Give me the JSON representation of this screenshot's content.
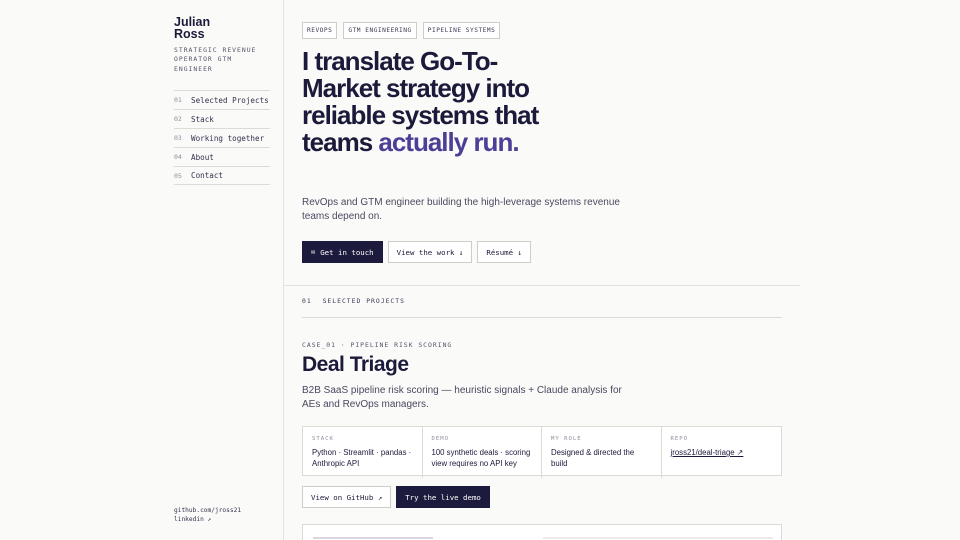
{
  "brand": {
    "name": "Julian Ross",
    "role": "STRATEGIC REVENUE OPERATOR GTM ENGINEER"
  },
  "nav": [
    {
      "num": "01",
      "label": "Selected Projects"
    },
    {
      "num": "02",
      "label": "Stack"
    },
    {
      "num": "03",
      "label": "Working together"
    },
    {
      "num": "04",
      "label": "About"
    },
    {
      "num": "05",
      "label": "Contact"
    }
  ],
  "side_links": {
    "github": "github.com/jross21",
    "linkedin": "linkedin ↗"
  },
  "tags": [
    "REVOPS",
    "GTM ENGINEERING",
    "PIPELINE SYSTEMS"
  ],
  "hero": {
    "headline": "I translate Go-To-Market strategy into reliable systems that teams",
    "accent": "actually run.",
    "lede": "RevOps and GTM engineer building the high-leverage systems revenue teams depend on."
  },
  "ctas": {
    "contact_icon": "✉",
    "contact": "Get in touch",
    "work": "View the work ↓",
    "resume": "Résumé ↓"
  },
  "section": {
    "num": "01",
    "label": "SELECTED PROJECTS"
  },
  "case": {
    "eyebrow": "CASE_01 · PIPELINE RISK SCORING",
    "title": "Deal Triage",
    "desc": "B2B SaaS pipeline risk scoring — heuristic signals + Claude analysis for AEs and RevOps managers.",
    "facts": [
      {
        "key": "STACK",
        "value": "Python · Streamlit · pandas · Anthropic API"
      },
      {
        "key": "DEMO",
        "value": "100 synthetic deals · scoring view requires no API key"
      },
      {
        "key": "MY ROLE",
        "value": "Designed & directed the build"
      },
      {
        "key": "REPO",
        "value": "jross21/deal-triage ↗"
      }
    ],
    "github_btn": "View on GitHub ↗",
    "demo_btn": "Try the live demo"
  }
}
